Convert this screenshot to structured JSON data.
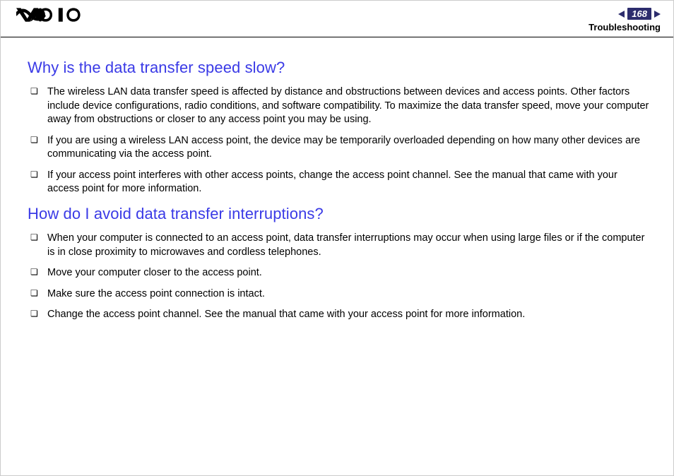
{
  "header": {
    "page_number": "168",
    "section": "Troubleshooting"
  },
  "sections": [
    {
      "heading": "Why is the data transfer speed slow?",
      "items": [
        "The wireless LAN data transfer speed is affected by distance and obstructions between devices and access points. Other factors include device configurations, radio conditions, and software compatibility. To maximize the data transfer speed, move your computer away from obstructions or closer to any access point you may be using.",
        "If you are using a wireless LAN access point, the device may be temporarily overloaded depending on how many other devices are communicating via the access point.",
        "If your access point interferes with other access points, change the access point channel. See the manual that came with your access point for more information."
      ]
    },
    {
      "heading": "How do I avoid data transfer interruptions?",
      "items": [
        "When your computer is connected to an access point, data transfer interruptions may occur when using large files or if the computer is in close proximity to microwaves and cordless telephones.",
        "Move your computer closer to the access point.",
        "Make sure the access point connection is intact.",
        "Change the access point channel. See the manual that came with your access point for more information."
      ]
    }
  ]
}
